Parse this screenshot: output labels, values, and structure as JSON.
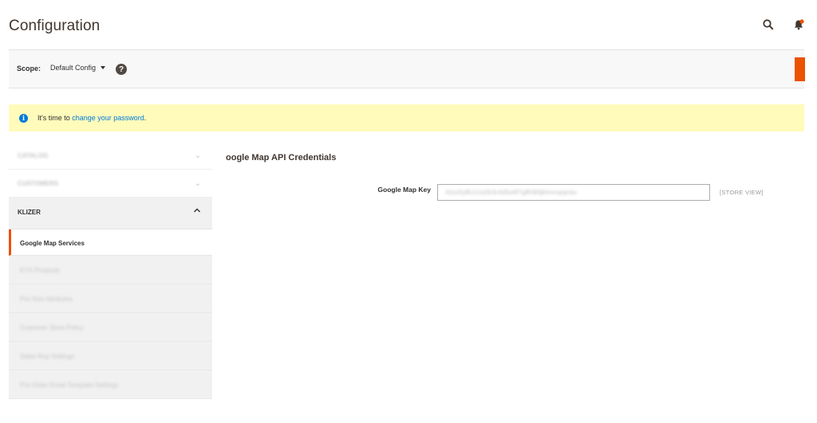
{
  "header": {
    "title": "Configuration"
  },
  "scope_bar": {
    "label": "Scope:",
    "selected": "Default Config",
    "help": "?"
  },
  "notice": {
    "icon": "i",
    "prefix": "It's time to ",
    "link": "change your password",
    "suffix": "."
  },
  "sidebar": {
    "sections_collapsed": [
      {
        "label": "CATALOG"
      },
      {
        "label": "CUSTOMERS"
      }
    ],
    "active_section": {
      "label": "KLIZER"
    },
    "items": [
      {
        "label": "Google Map Services"
      },
      {
        "label": "KYS Products"
      },
      {
        "label": "Pre Size Attributes"
      },
      {
        "label": "Customer Store Policy"
      },
      {
        "label": "Sales Rep Settings"
      },
      {
        "label": "Pre Order Email Template Settings"
      }
    ]
  },
  "main": {
    "section_title": "oogle Map API Credentials",
    "field": {
      "label": "Google Map Key",
      "value": "AIzaSyBUx1a2b3c4d5e6f7g8h9i0jklmnopqrstu",
      "scope": "[STORE VIEW]"
    }
  },
  "colors": {
    "accent": "#eb5202",
    "notice_bg": "#fffbbb",
    "link": "#007bdb"
  }
}
